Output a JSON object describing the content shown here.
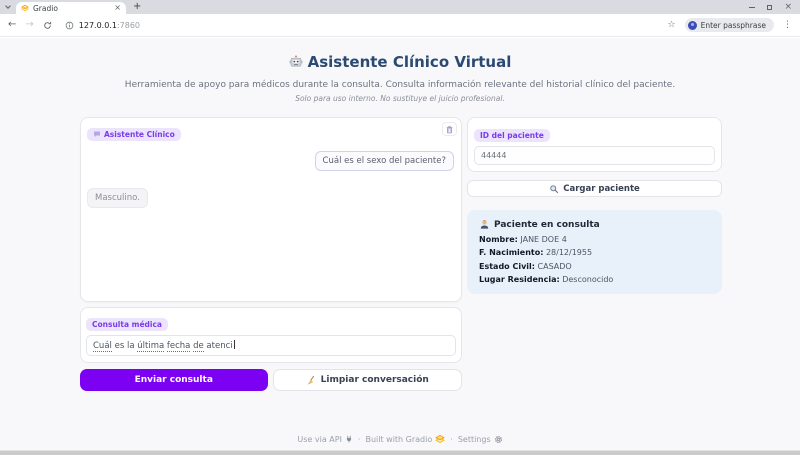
{
  "browser": {
    "tab": {
      "title": "Gradio"
    },
    "url": {
      "host": "127.0.0.1",
      "port": ":7860"
    },
    "passphrase_label": "Enter passphrase"
  },
  "glyphs": {
    "back": "←",
    "forward": "→",
    "star": "☆",
    "menu": "⋮",
    "new_tab": "+",
    "tab_close": "×",
    "win_close": "×"
  },
  "header": {
    "icon": "robot-icon",
    "title": "Asistente Clínico Virtual",
    "subtitle": "Herramienta de apoyo para médicos durante la consulta. Consulta información relevante del historial clínico del paciente.",
    "note": "Solo para uso interno. No sustituye el juicio profesional."
  },
  "chat": {
    "label": "Asistente Clínico",
    "label_icon": "chat-bubble-icon",
    "clear_icon": "trash-icon",
    "messages": [
      {
        "role": "user",
        "text": "Cuál es el sexo del paciente?"
      },
      {
        "role": "bot",
        "text": "Masculino."
      }
    ]
  },
  "query": {
    "label": "Consulta médica",
    "value": "Cuál es la última fecha de atenci",
    "segments": [
      {
        "text": "Cuál",
        "misspelled": true
      },
      {
        "text": " es la ",
        "misspelled": false
      },
      {
        "text": "última",
        "misspelled": true
      },
      {
        "text": " ",
        "misspelled": false
      },
      {
        "text": "fecha",
        "misspelled": true
      },
      {
        "text": " ",
        "misspelled": false
      },
      {
        "text": "de",
        "misspelled": true
      },
      {
        "text": " atenci",
        "misspelled": false
      }
    ]
  },
  "actions": {
    "send": "Enviar consulta",
    "clear": "Limpiar conversación",
    "clear_icon": "broom-icon"
  },
  "patient_lookup": {
    "label": "ID del paciente",
    "value": "44444",
    "button": "Cargar paciente",
    "button_icon": "magnifier-icon"
  },
  "patient_card": {
    "icon": "person-icon",
    "title": "Paciente en consulta",
    "fields": [
      {
        "label": "Nombre:",
        "value": "JANE DOE 4"
      },
      {
        "label": "F. Nacimiento:",
        "value": "28/12/1955"
      },
      {
        "label": "Estado Civil:",
        "value": "CASADO"
      },
      {
        "label": "Lugar Residencia:",
        "value": "Desconocido"
      }
    ]
  },
  "footer": {
    "api": "Use via API",
    "api_icon": "plug-icon",
    "sep1": "·",
    "built": "Built with Gradio",
    "gradio_icon": "gradio-logo-icon",
    "sep2": "·",
    "settings": "Settings",
    "settings_icon": "gear-icon"
  },
  "colors": {
    "accent_purple": "#7C00F2",
    "title_blue": "#2B4A73",
    "badge_bg": "#ECE4FD",
    "badge_text": "#7A3BEA",
    "patient_card_bg": "#E8F1FA",
    "gradio_orange": "#F59E0B"
  }
}
